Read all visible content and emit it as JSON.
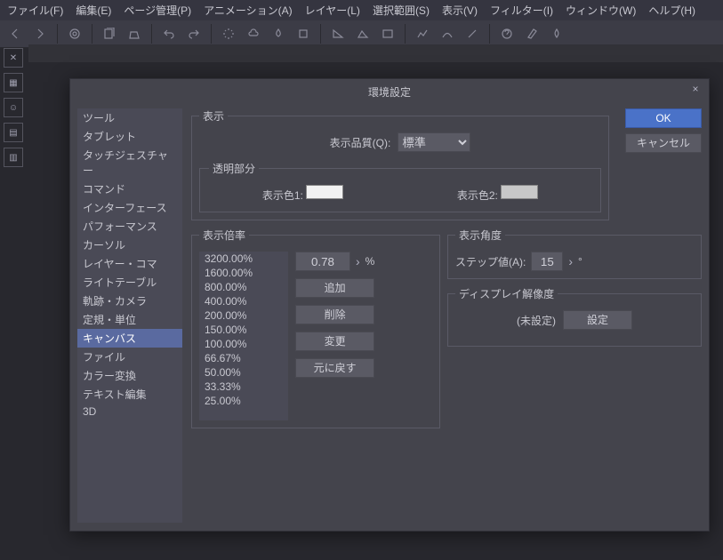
{
  "menu": [
    "ファイル(F)",
    "編集(E)",
    "ページ管理(P)",
    "アニメーション(A)",
    "レイヤー(L)",
    "選択範囲(S)",
    "表示(V)",
    "フィルター(I)",
    "ウィンドウ(W)",
    "ヘルプ(H)"
  ],
  "dialog": {
    "title": "環境設定",
    "close": "×",
    "ok": "OK",
    "cancel": "キャンセル",
    "categories": [
      "ツール",
      "タブレット",
      "タッチジェスチャー",
      "コマンド",
      "インターフェース",
      "パフォーマンス",
      "カーソル",
      "レイヤー・コマ",
      "ライトテーブル",
      "軌跡・カメラ",
      "定規・単位",
      "キャンバス",
      "ファイル",
      "カラー変換",
      "テキスト編集",
      "3D"
    ],
    "selected_category": "キャンバス",
    "display": {
      "legend": "表示",
      "quality_label": "表示品質(Q):",
      "quality_value": "標準",
      "transparency_legend": "透明部分",
      "color1_label": "表示色1:",
      "color2_label": "表示色2:",
      "color1": "#f2f2f2",
      "color2": "#c8c8c8"
    },
    "zoom": {
      "legend": "表示倍率",
      "values": [
        "3200.00%",
        "1600.00%",
        "800.00%",
        "400.00%",
        "200.00%",
        "150.00%",
        "100.00%",
        "66.67%",
        "50.00%",
        "33.33%",
        "25.00%"
      ],
      "input": "0.78",
      "unit": "%",
      "add": "追加",
      "delete": "削除",
      "change": "変更",
      "reset": "元に戻す"
    },
    "angle": {
      "legend": "表示角度",
      "step_label": "ステップ値(A):",
      "step_value": "15",
      "unit": "°"
    },
    "resolution": {
      "legend": "ディスプレイ解像度",
      "status": "(未設定)",
      "set": "設定"
    }
  }
}
